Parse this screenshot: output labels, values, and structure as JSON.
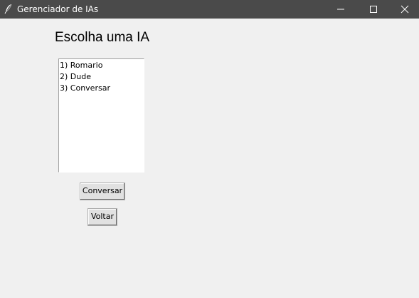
{
  "window": {
    "title": "Gerenciador de IAs",
    "icon": "feather-icon",
    "controls": [
      "minimize-icon",
      "maximize-icon",
      "close-icon"
    ]
  },
  "main": {
    "heading": "Escolha uma IA",
    "list": {
      "items": [
        {
          "label": "1) Romario"
        },
        {
          "label": "2) Dude"
        },
        {
          "label": "3) Conversar"
        }
      ]
    },
    "buttons": {
      "conversar_label": "Conversar",
      "voltar_label": "Voltar"
    }
  },
  "colors": {
    "titlebar": "#4a4a4a",
    "background": "#f0f0f0",
    "list_background": "#ffffff",
    "button_face": "#e1e1e1"
  }
}
